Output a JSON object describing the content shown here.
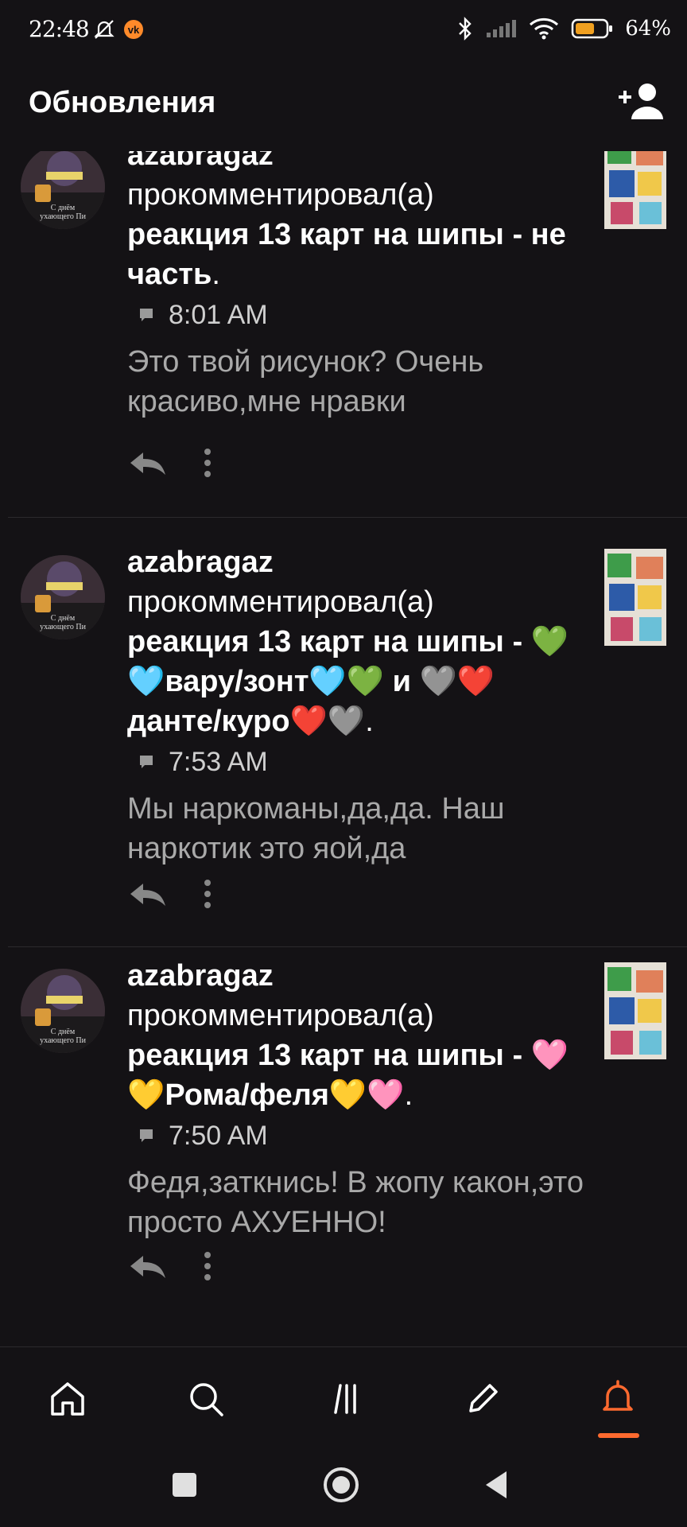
{
  "status_bar": {
    "time": "22:48",
    "battery_percent": "64%",
    "battery_level": 0.64,
    "icons": [
      "mute-bell-icon",
      "vk-icon",
      "bluetooth-icon",
      "signal-icon",
      "wifi-icon",
      "battery-icon"
    ]
  },
  "header": {
    "title": "Обновления",
    "add_user_icon": "add-user-icon"
  },
  "notifications": [
    {
      "author": "azabragaz",
      "action": "прокомментировал(а)",
      "post_title": "реакция 13 карт на шипы - не часть",
      "time": "8:01 AM",
      "comment": "Это твой рисунок? Очень красиво,мне нравки",
      "avatar_caption": "С днём\nухающего Пи"
    },
    {
      "author": "azabragaz",
      "action": "прокомментировал(а)",
      "post_title": "реакция 13 карт на шипы - 💚🩵вару/зонт🩵💚 и 🩶❤️данте/куро❤️🩶",
      "time": "7:53 AM",
      "comment": "Мы наркоманы,да,да. Наш наркотик это яой,да",
      "avatar_caption": "С днём\nухающего Пи"
    },
    {
      "author": "azabragaz",
      "action": "прокомментировал(а)",
      "post_title": "реакция 13 карт на шипы - 🩷💛Рома/феля💛🩷",
      "time": "7:50 AM",
      "comment": "Федя,заткнись! В жопу какон,это просто АХУЕННО!",
      "avatar_caption": "С днём\nухающего Пи"
    }
  ],
  "bottom_nav": {
    "items": [
      "home-icon",
      "search-icon",
      "feed-icon",
      "pencil-icon",
      "bell-icon"
    ],
    "active": "bell-icon",
    "accent": "#ff6a2f"
  },
  "system_nav": [
    "recents-icon",
    "home-circle-icon",
    "back-icon"
  ]
}
